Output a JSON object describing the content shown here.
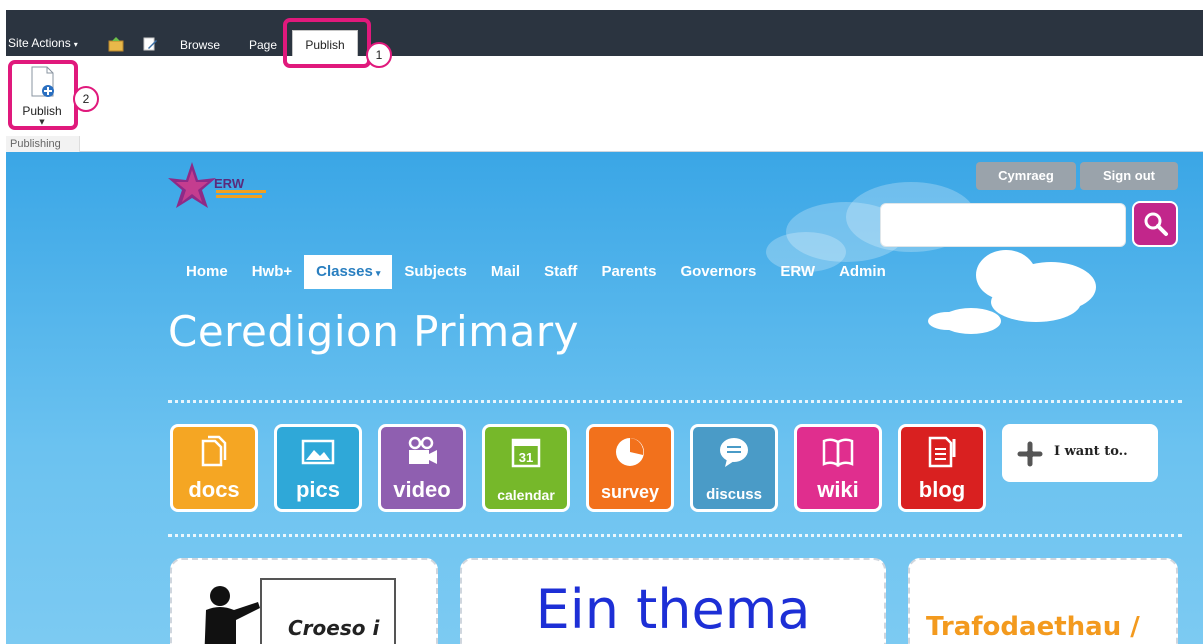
{
  "topbar": {
    "site_actions": "Site Actions",
    "tabs": [
      "Browse",
      "Page",
      "Publish"
    ]
  },
  "ribbon": {
    "publish_button_label": "Publish",
    "group_label": "Publishing"
  },
  "callouts": [
    "1",
    "2"
  ],
  "header": {
    "logo_text": "ERW",
    "language_button": "Cymraeg",
    "signout_button": "Sign out",
    "search_placeholder": ""
  },
  "nav": {
    "items": [
      "Home",
      "Hwb+",
      "Classes",
      "Subjects",
      "Mail",
      "Staff",
      "Parents",
      "Governors",
      "ERW",
      "Admin"
    ]
  },
  "site_title": "Ceredigion Primary",
  "tiles": [
    {
      "label": "docs",
      "color": "#f5a623"
    },
    {
      "label": "pics",
      "color": "#2fa8d8"
    },
    {
      "label": "video",
      "color": "#8f5fb0"
    },
    {
      "label": "calendar",
      "color": "#76b82a"
    },
    {
      "label": "survey",
      "color": "#f2711c"
    },
    {
      "label": "discuss",
      "color": "#4a9bc7"
    },
    {
      "label": "wiki",
      "color": "#e02e8e"
    },
    {
      "label": "blog",
      "color": "#d92020"
    }
  ],
  "iwant": {
    "label": "I want to.."
  },
  "panels": {
    "left_sign": "Croeso i",
    "middle_title": "Ein thema",
    "right_title": "Trafodaethau /"
  },
  "colors": {
    "accent": "#e0197c",
    "topbar": "#2b3440",
    "sky": "#3aa6e6",
    "search_button": "#c2268b"
  }
}
